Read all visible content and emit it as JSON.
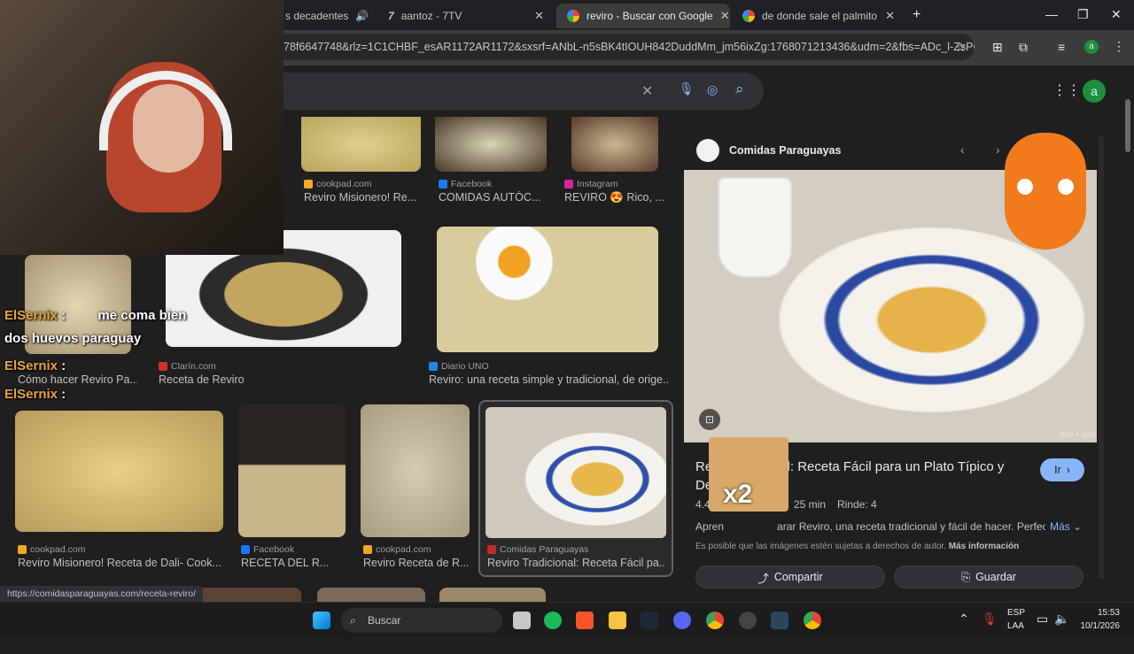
{
  "tabs": [
    {
      "title": "s decadentes",
      "active": false
    },
    {
      "title": "aantoz - 7TV",
      "active": false
    },
    {
      "title": "reviro - Buscar con Google",
      "active": true
    },
    {
      "title": "de donde sale el palmito - Busc",
      "active": false
    }
  ],
  "address_bar": {
    "url": "78f6647748&rlz=1C1CHBF_esAR1172AR1172&sxsrf=ANbL-n5sBK4tIOUH842DuddMm_jm56ixZg:1768071213436&udm=2&fbs=ADc_l-ZsP6SKv..."
  },
  "profile_initial": "a",
  "top_row": [
    {
      "source": "cookpad.com",
      "caption": "Reviro Misionero! Re..."
    },
    {
      "source": "Facebook",
      "caption": "COMIDAS AUTÓC..."
    },
    {
      "source": "Instagram",
      "caption": "REVIRO 😍 Rico, ..."
    }
  ],
  "middle_row": [
    {
      "source": "",
      "caption": "Cómo hacer Reviro Pa..."
    },
    {
      "source": "Clarín.com",
      "caption": "Receta de Reviro"
    },
    {
      "source": "Diario UNO",
      "caption": "Reviro: una receta simple y tradicional, de orige..."
    }
  ],
  "bottom_row": [
    {
      "source": "cookpad.com",
      "caption": "Reviro Misionero! Receta de Dali- Cook..."
    },
    {
      "source": "Facebook",
      "caption": "RECETA DEL R..."
    },
    {
      "source": "cookpad.com",
      "caption": "Reviro Receta de R..."
    },
    {
      "source": "Comidas Paraguayas",
      "caption": "Reviro Tradicional: Receta Fácil pa..."
    }
  ],
  "panel": {
    "source": "Comidas Paraguayas",
    "image_size": "800 × 534",
    "title_start": "Re",
    "title_rest": "al: Receta Fácil para un Plato Típico y",
    "title_line2": "De",
    "go_label": "Ir",
    "rating": "4.4",
    "time": "25 min",
    "serves": "Rinde: 4",
    "desc_start": "Apren",
    "desc_rest": "arar Reviro, una receta tradicional y fácil de hacer. Perfect...",
    "more": "Más",
    "copyright": "Es posible que las imágenes estén sujetas a derechos de autor.",
    "more_info": "Más información",
    "share": "Compartir",
    "save": "Guardar"
  },
  "chat": [
    {
      "user": "ElSernix",
      "message": "me coma bien"
    },
    {
      "user": "",
      "message": "dos huevos paraguay"
    },
    {
      "user": "ElSernix",
      "message": ":"
    },
    {
      "user": "ElSernix",
      "message": ":"
    }
  ],
  "emote_text": "x2",
  "status_url": "https://comidasparaguayas.com/receta-reviro/",
  "taskbar": {
    "search_label": "Buscar",
    "lang1": "ESP",
    "lang2": "LAA",
    "time": "15:53",
    "date": "10/1/2026"
  },
  "colors": {
    "accent_blue": "#8ab4f8",
    "chat_name": "#e8a33a",
    "bg": "#1f1f1f"
  }
}
